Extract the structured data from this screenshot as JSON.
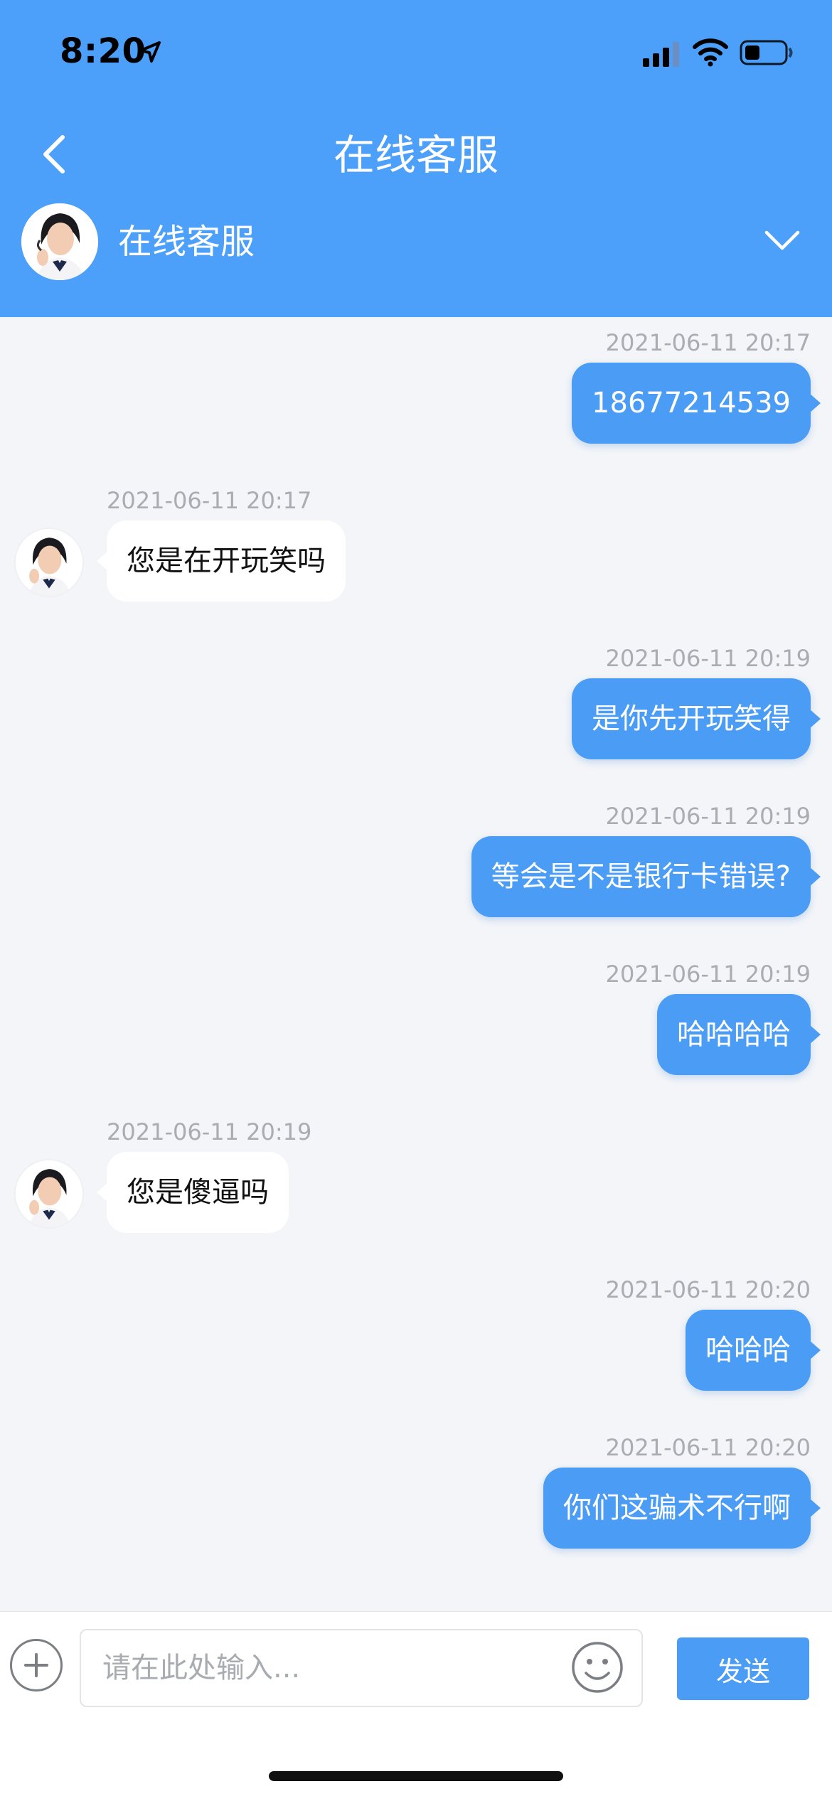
{
  "status_bar": {
    "time": "8:20"
  },
  "header": {
    "title": "在线客服"
  },
  "agent": {
    "name": "在线客服"
  },
  "messages": [
    {
      "side": "out",
      "time": "2021-06-11 20:17",
      "text": "18677214539"
    },
    {
      "side": "in",
      "time": "2021-06-11 20:17",
      "text": "您是在开玩笑吗"
    },
    {
      "side": "out",
      "time": "2021-06-11 20:19",
      "text": "是你先开玩笑得"
    },
    {
      "side": "out",
      "time": "2021-06-11 20:19",
      "text": "等会是不是银行卡错误?"
    },
    {
      "side": "out",
      "time": "2021-06-11 20:19",
      "text": "哈哈哈哈"
    },
    {
      "side": "in",
      "time": "2021-06-11 20:19",
      "text": "您是傻逼吗"
    },
    {
      "side": "out",
      "time": "2021-06-11 20:20",
      "text": "哈哈哈"
    },
    {
      "side": "out",
      "time": "2021-06-11 20:20",
      "text": "你们这骗术不行啊"
    }
  ],
  "input": {
    "placeholder": "请在此处输入...",
    "value": ""
  },
  "send_label": "发送",
  "colors": {
    "header_bg": "#4da0fa",
    "outgoing_bubble": "#4b9cf5",
    "incoming_bubble": "#ffffff",
    "background": "#f3f5f8"
  }
}
